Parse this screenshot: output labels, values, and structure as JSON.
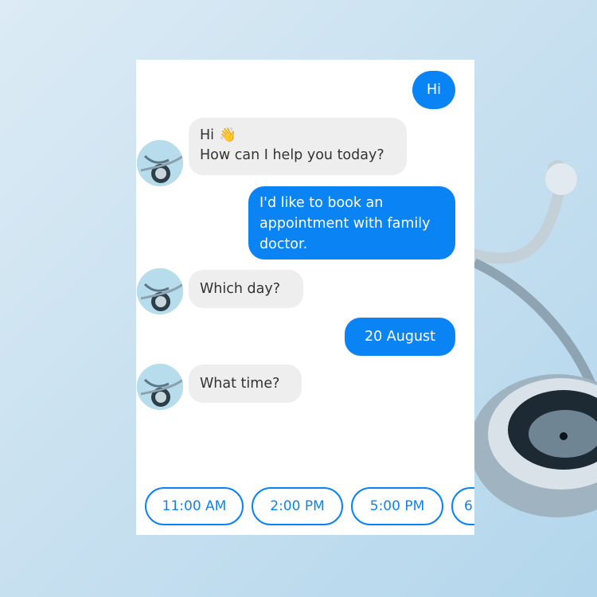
{
  "messages": [
    {
      "from": "user",
      "text": "Hi"
    },
    {
      "from": "bot",
      "line1": "Hi",
      "icon": "waving-hand-icon",
      "line2": "How can I help you today?"
    },
    {
      "from": "user",
      "text": "I'd like to book an appointment with family doctor."
    },
    {
      "from": "bot",
      "text": "Which day?"
    },
    {
      "from": "user",
      "text": "20 August"
    },
    {
      "from": "bot",
      "text": "What time?"
    }
  ],
  "quick_replies": [
    "11:00 AM",
    "2:00 PM",
    "5:00 PM",
    "6"
  ],
  "colors": {
    "accent": "#0a84f5",
    "bot_bubble": "#eeeeee",
    "user_text": "#ffffff"
  }
}
